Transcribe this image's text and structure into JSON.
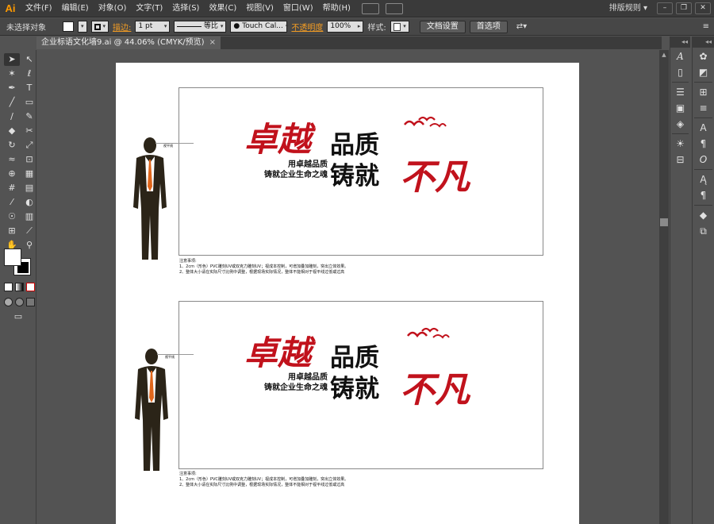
{
  "app": {
    "logo": "Ai",
    "menu": [
      "文件(F)",
      "编辑(E)",
      "对象(O)",
      "文字(T)",
      "选择(S)",
      "效果(C)",
      "视图(V)",
      "窗口(W)",
      "帮助(H)"
    ],
    "workspace": "排版规则 ▾",
    "window_buttons": [
      "–",
      "❐",
      "✕"
    ]
  },
  "control_bar": {
    "selection": "未选择对象",
    "stroke_label": "描边:",
    "stroke_weight": "1 pt",
    "stroke_profile": "等比",
    "brush": "Touch Cal...",
    "opacity_label": "不透明度",
    "opacity_value": "100%",
    "style_label": "样式:",
    "doc_setup": "文档设置",
    "prefs": "首选项"
  },
  "document": {
    "tab_title": "企业标语文化墙9.ai @ 44.06% (CMYK/预览)",
    "tab_close": "×"
  },
  "artwork": {
    "red_title": "卓越",
    "black_line1": "品质",
    "black_line2": "铸就",
    "red_calligraphy": "不凡",
    "sub_line1": "用卓越品质",
    "sub_line2": "铸就企业生命之魂",
    "height_tag": "视平线",
    "notes_title": "注意事项:",
    "notes_line1": "1、2cm（形色）PVC雕刻UV或双克力雕刻UV；视成本控制，可增加叠加雕刻，突出立体效果。",
    "notes_line2": "2、整体大小请在实际尺寸比例中调整，根据现场实际情况，整体不能相对于视平线过低或过高"
  },
  "colors": {
    "accent_red": "#c1121c",
    "tie_orange": "#e0661b",
    "ai_orange": "#ff9a00"
  },
  "icons": {
    "tools": [
      "selection-tool-icon",
      "direct-selection-tool-icon",
      "magic-wand-icon",
      "lasso-icon",
      "pen-icon",
      "type-icon",
      "line-icon",
      "rectangle-icon",
      "paintbrush-icon",
      "pencil-icon",
      "blob-brush-icon",
      "scissors-icon",
      "rotate-icon",
      "scale-icon",
      "warp-icon",
      "free-transform-icon",
      "shape-builder-icon",
      "perspective-icon",
      "mesh-icon",
      "gradient-icon",
      "eyedropper-icon",
      "blend-icon",
      "symbol-sprayer-icon",
      "graph-icon",
      "artboard-icon",
      "slice-icon",
      "hand-icon",
      "zoom-icon"
    ]
  }
}
